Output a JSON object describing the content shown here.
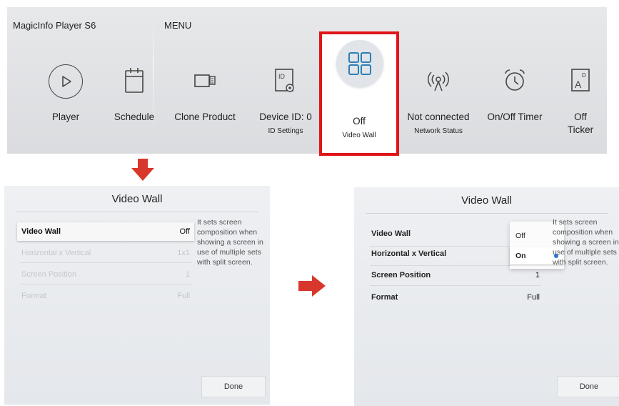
{
  "menu": {
    "app_title": "MagicInfo Player S6",
    "menu_title": "MENU",
    "items": [
      {
        "label": "Player",
        "sub": "",
        "icon": "play-icon"
      },
      {
        "label": "Schedule",
        "sub": "",
        "icon": "calendar-icon"
      },
      {
        "label": "Clone Product",
        "sub": "",
        "icon": "clone-icon"
      },
      {
        "label": "Device ID: 0",
        "sub": "ID Settings",
        "icon": "device-id-icon"
      },
      {
        "label": "Off",
        "sub": "Video Wall",
        "icon": "video-wall-icon"
      },
      {
        "label": "Not connected",
        "sub": "Network Status",
        "icon": "network-icon"
      },
      {
        "label": "On/Off Timer",
        "sub": "",
        "icon": "alarm-clock-icon"
      },
      {
        "label": "Off",
        "sub": "Ticker",
        "icon": "ticker-icon"
      }
    ]
  },
  "left_panel": {
    "title": "Video Wall",
    "rows": [
      {
        "label": "Video Wall",
        "value": "Off"
      },
      {
        "label": "Horizontal x Vertical",
        "value": "1x1"
      },
      {
        "label": "Screen Position",
        "value": "1"
      },
      {
        "label": "Format",
        "value": "Full"
      }
    ],
    "description": "It sets screen composition when showing a screen in use of multiple sets with split screen.",
    "done_label": "Done"
  },
  "right_panel": {
    "title": "Video Wall",
    "rows": [
      {
        "label": "Video Wall",
        "value": ""
      },
      {
        "label": "Horizontal x Vertical",
        "value": ""
      },
      {
        "label": "Screen Position",
        "value": "1"
      },
      {
        "label": "Format",
        "value": "Full"
      }
    ],
    "dropdown": {
      "options": [
        "Off",
        "On"
      ],
      "selected": "On"
    },
    "description": "It sets screen composition when showing a screen in use of multiple sets with split screen.",
    "done_label": "Done"
  },
  "colors": {
    "highlight": "#e0151a",
    "arrow": "#d8382b",
    "check": "#2a74d8"
  }
}
